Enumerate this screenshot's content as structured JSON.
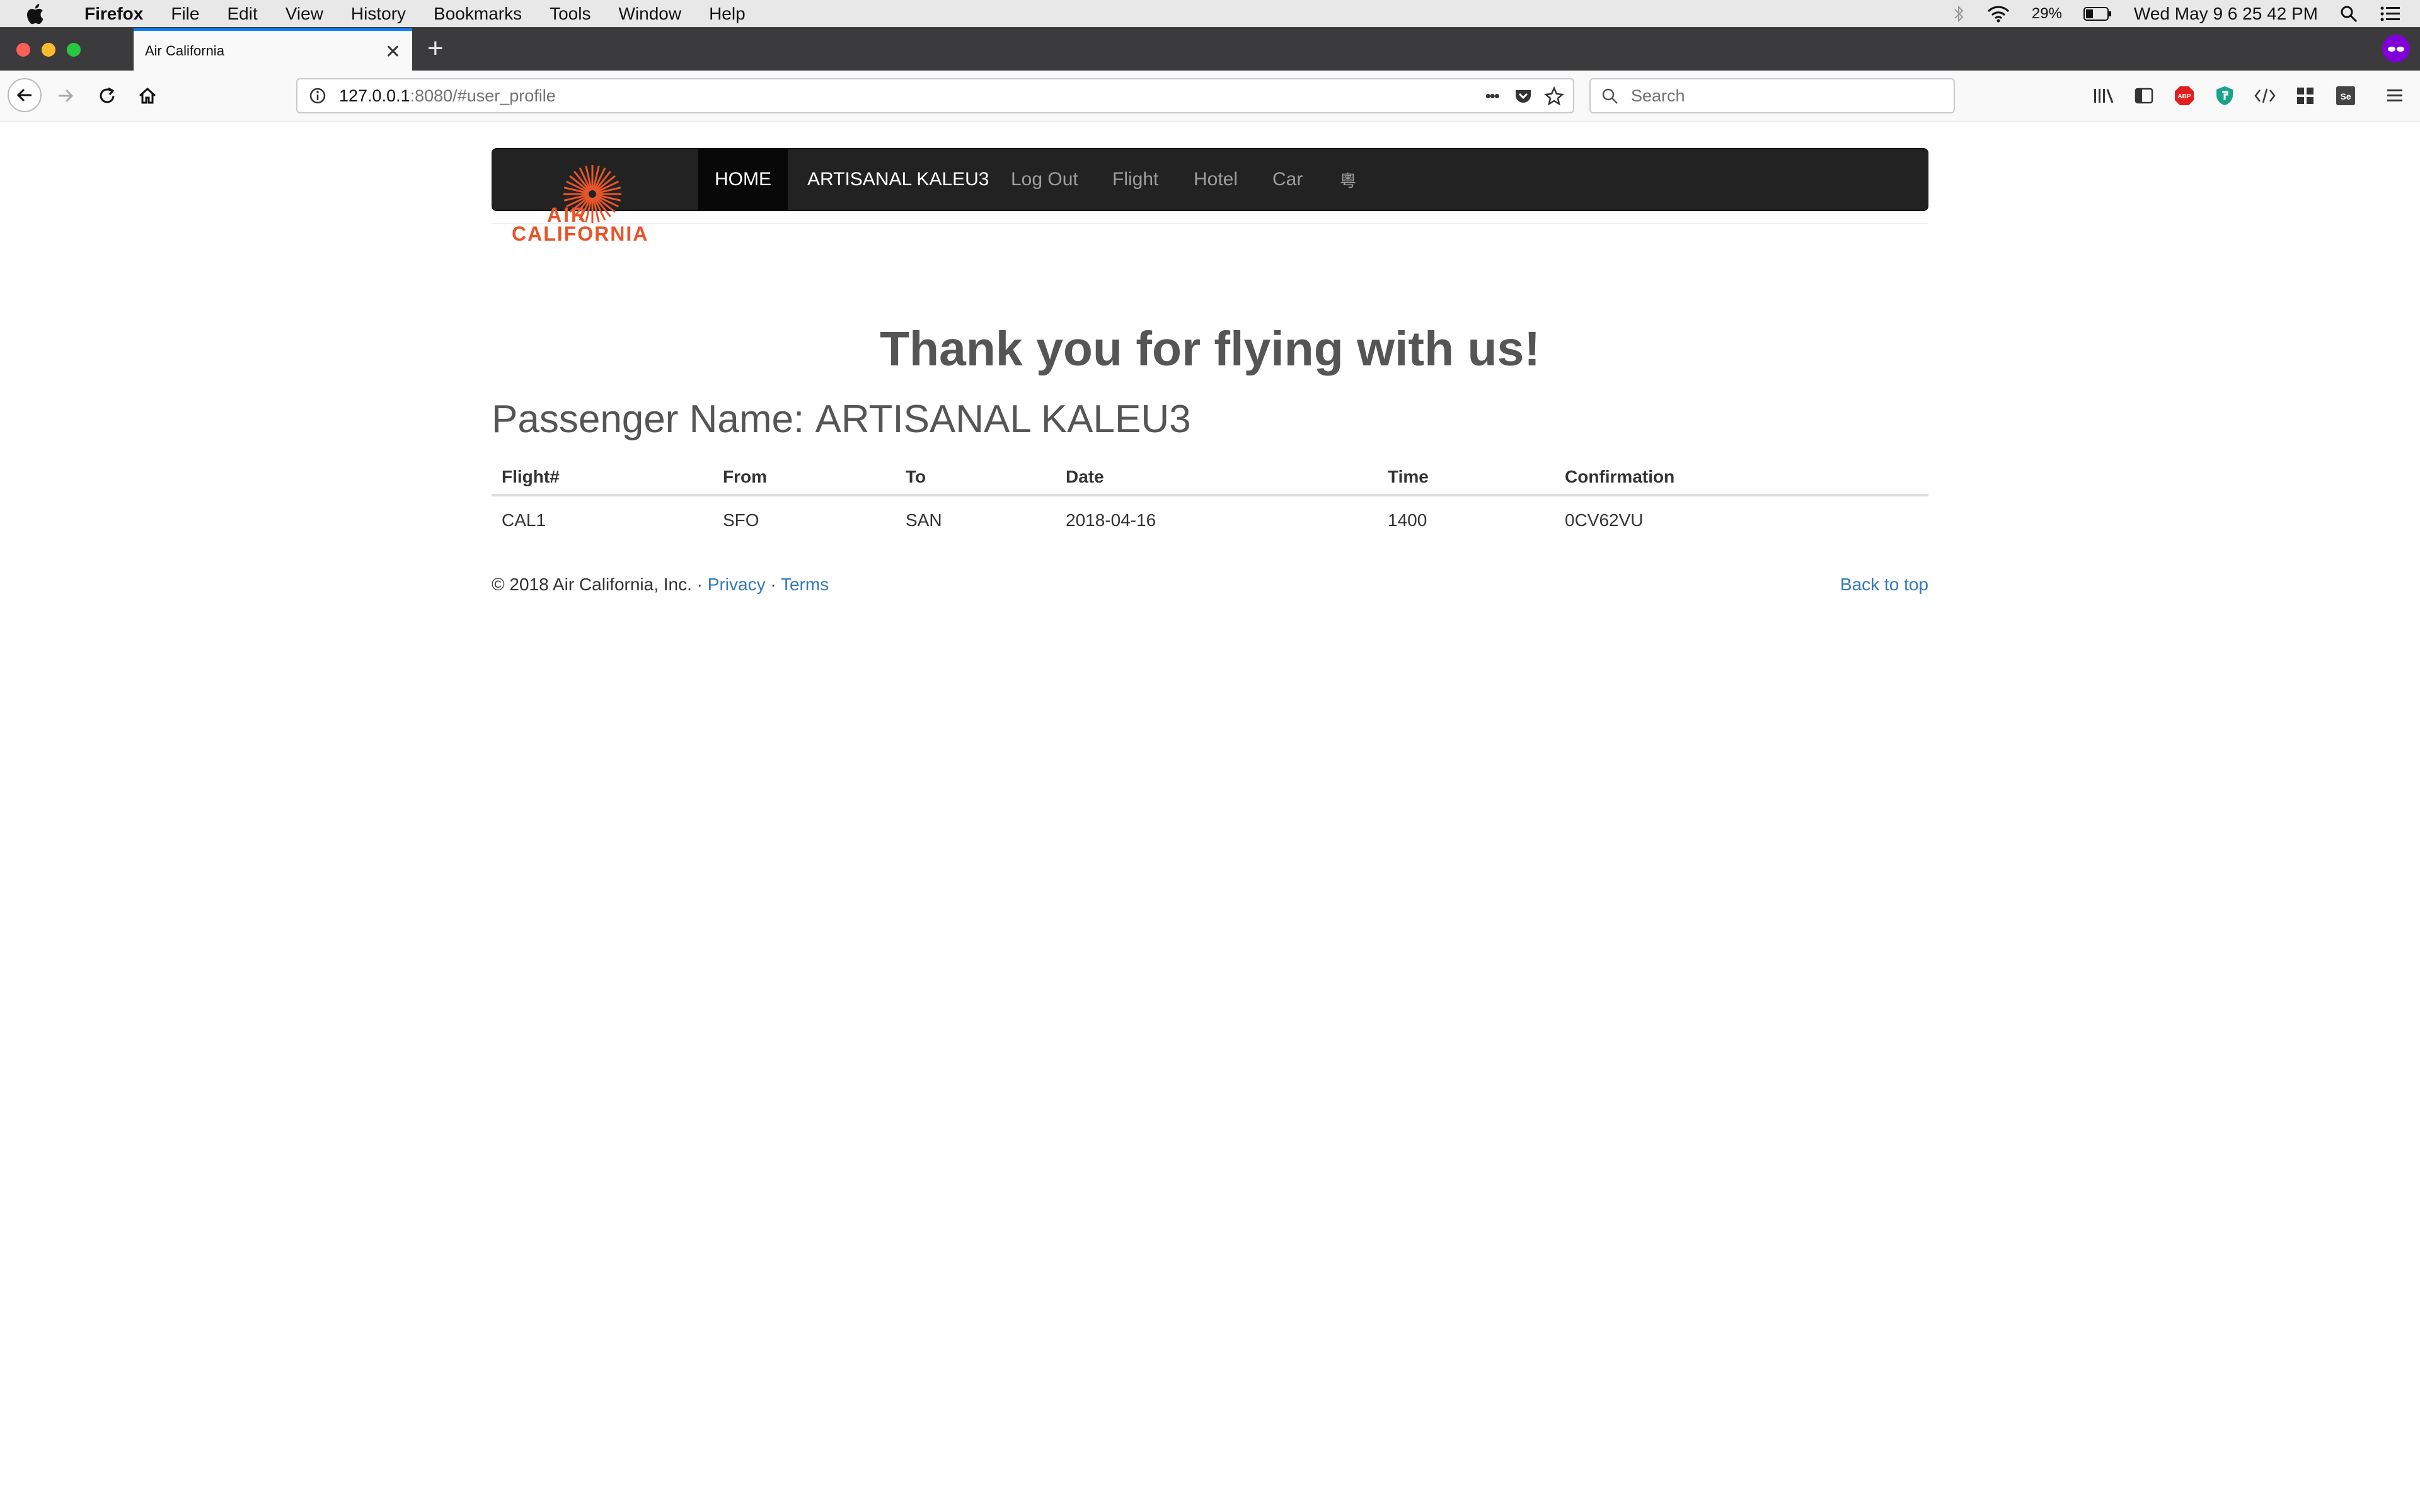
{
  "os_menubar": {
    "app_name": "Firefox",
    "menus": [
      "File",
      "Edit",
      "View",
      "History",
      "Bookmarks",
      "Tools",
      "Window",
      "Help"
    ],
    "battery": "29%",
    "clock": "Wed May 9  6 25 42 PM"
  },
  "browser": {
    "tab_title": "Air California",
    "tab_close": "✕",
    "new_tab": "+",
    "url_host": "127.0.0.1",
    "url_rest": ":8080/#user_profile",
    "search_placeholder": "Search",
    "url_more": "•••"
  },
  "site": {
    "logo_line1": "AIR",
    "logo_line2": "CALIFORNIA",
    "logo_color": "#e8542a",
    "nav": [
      {
        "label": "HOME"
      },
      {
        "label": "ARTISANAL KALEU3"
      },
      {
        "label": "Log Out"
      },
      {
        "label": "Flight"
      },
      {
        "label": "Hotel"
      },
      {
        "label": "Car"
      },
      {
        "label": "粵"
      }
    ]
  },
  "main": {
    "headline": "Thank you for flying with us!",
    "passenger_label": "Passenger Name: ",
    "passenger_name": "ARTISANAL KALEU3",
    "table": {
      "headers": [
        "Flight#",
        "From",
        "To",
        "Date",
        "Time",
        "Confirmation"
      ],
      "rows": [
        [
          "CAL1",
          "SFO",
          "SAN",
          "2018-04-16",
          "1400",
          "0CV62VU"
        ]
      ]
    }
  },
  "footer": {
    "copyright": "© 2018 Air California, Inc. · ",
    "privacy": "Privacy",
    "separator": " · ",
    "terms": "Terms",
    "back_to_top": "Back to top"
  }
}
